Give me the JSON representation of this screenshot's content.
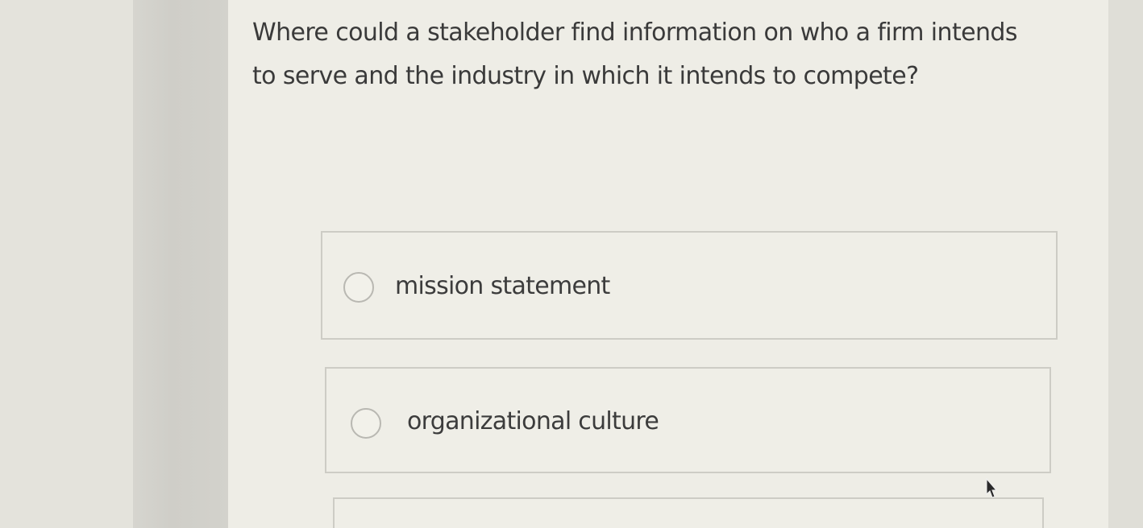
{
  "question": {
    "text": "Where could a stakeholder find information on who a firm intends to serve and the industry in which it intends to compete?"
  },
  "options": [
    {
      "label": "mission statement",
      "selected": false
    },
    {
      "label": "organizational culture",
      "selected": false
    },
    {
      "label": "",
      "selected": false
    }
  ],
  "colors": {
    "background": "#e6e5de",
    "panel": "#eeede6",
    "border": "#cdccc5",
    "text": "#3a3a3a"
  },
  "icons": {
    "radio": "radio-button-unchecked-icon",
    "cursor": "mouse-pointer-icon"
  }
}
